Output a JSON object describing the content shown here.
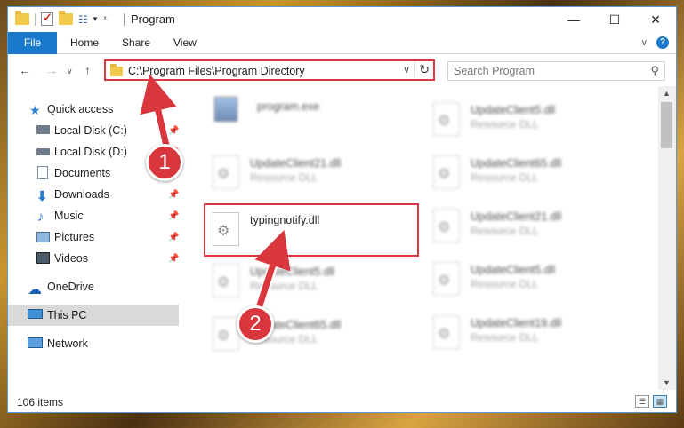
{
  "window": {
    "title": "Program",
    "controls": {
      "minimize": "—",
      "maximize": "☐",
      "close": "✕"
    }
  },
  "ribbon": {
    "tabs": [
      "File",
      "Home",
      "Share",
      "View"
    ],
    "help": "?"
  },
  "address": {
    "path": "C:\\Program Files\\Program Directory",
    "search_placeholder": "Search Program"
  },
  "nav": {
    "items": [
      {
        "label": "Quick access",
        "icon": "star-icon",
        "pinned": false
      },
      {
        "label": "Local Disk (C:)",
        "icon": "drive-icon",
        "pinned": true
      },
      {
        "label": "Local Disk (D:)",
        "icon": "drive-icon",
        "pinned": true
      },
      {
        "label": "Documents",
        "icon": "documents-icon",
        "pinned": true
      },
      {
        "label": "Downloads",
        "icon": "download-icon",
        "pinned": true
      },
      {
        "label": "Music",
        "icon": "music-icon",
        "pinned": true
      },
      {
        "label": "Pictures",
        "icon": "pictures-icon",
        "pinned": true
      },
      {
        "label": "Videos",
        "icon": "videos-icon",
        "pinned": true
      },
      {
        "label": "OneDrive",
        "icon": "cloud-icon",
        "pinned": false
      },
      {
        "label": "This PC",
        "icon": "computer-icon",
        "pinned": false,
        "selected": true
      },
      {
        "label": "Network",
        "icon": "network-icon",
        "pinned": false
      }
    ]
  },
  "files": {
    "left": [
      {
        "name": "program.exe",
        "type": ""
      },
      {
        "name": "UpdateClient21.dll",
        "type": "Resource DLL"
      },
      {
        "name": "typingnotify.dll",
        "type": ""
      },
      {
        "name": "UpdateClient5.dll",
        "type": "Resource DLL"
      },
      {
        "name": "UpdateClient65.dll",
        "type": "Resource DLL"
      }
    ],
    "right": [
      {
        "name": "UpdateClient5.dll",
        "type": "Resource DLL"
      },
      {
        "name": "UpdateClient65.dll",
        "type": "Resource DLL"
      },
      {
        "name": "UpdateClient21.dll",
        "type": "Resource DLL"
      },
      {
        "name": "UpdateClient5.dll",
        "type": "Resource DLL"
      },
      {
        "name": "UpdateClient19.dll",
        "type": "Resource DLL"
      }
    ]
  },
  "status": {
    "item_count": "106 items"
  },
  "annotations": {
    "step1": "1",
    "step2": "2",
    "color": "#d9363e"
  }
}
